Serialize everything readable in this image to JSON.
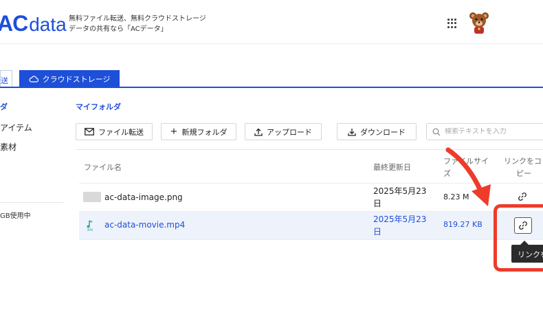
{
  "brand": {
    "logo_ac": "AC",
    "logo_data": "data",
    "tagline_line1": "無料ファイル転送、無料クラウドストレージ",
    "tagline_line2": "データの共有なら「ACデータ」"
  },
  "header": {
    "apps_icon": "grid-icon",
    "avatar_icon": "bear-avatar-icon"
  },
  "tabs": {
    "left_partial": "送",
    "active": "クラウドストレージ",
    "active_icon": "cloud-icon"
  },
  "sidebar": {
    "folder": "ダ",
    "item1": "アイテム",
    "item2": "素材",
    "usage": "GB使用中"
  },
  "main": {
    "breadcrumb": "マイフォルダ",
    "toolbar": {
      "transfer": "ファイル転送",
      "new_folder": "新規フォルダ",
      "upload": "アップロード",
      "download": "ダウンロード",
      "search_placeholder": "検索テキストを入力"
    },
    "table": {
      "headers": {
        "name": "ファイル名",
        "modified": "最終更新日",
        "size_line1": "ファイルサイ",
        "size_line2": "ズ",
        "link_line1": "リンクをコ",
        "link_line2": "ピー"
      },
      "rows": [
        {
          "name": "ac-data-image.png",
          "date_line1": "2025年5月23",
          "date_line2": "日",
          "size": "8.23 M"
        },
        {
          "name": "ac-data-movie.mp4",
          "date_line1": "2025年5月23",
          "date_line2": "日",
          "size": "819.27 KB"
        }
      ]
    },
    "tooltip": "リンクを"
  },
  "colors": {
    "brand_blue": "#1e4fd8",
    "annotation_red": "#ef3b2a",
    "row_highlight": "#eef2fb"
  }
}
